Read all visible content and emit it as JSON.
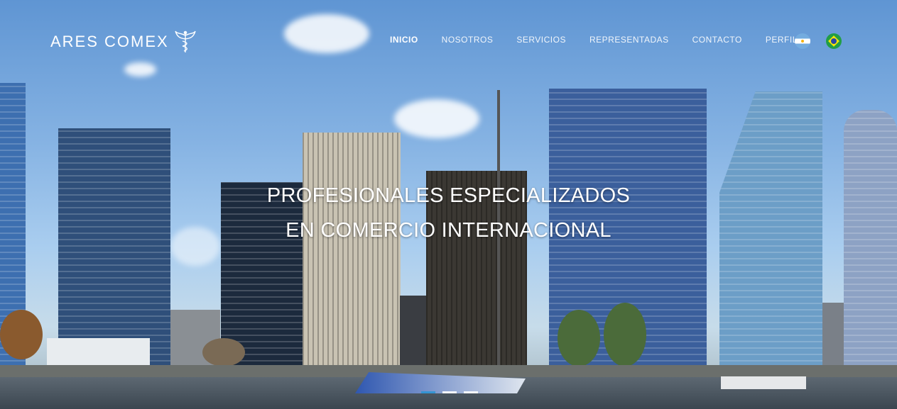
{
  "brand": {
    "name": "ARES COMEX",
    "logo_icon": "caduceus-wings-icon"
  },
  "nav": {
    "items": [
      {
        "label": "INICIO",
        "active": true
      },
      {
        "label": "NOSOTROS",
        "active": false
      },
      {
        "label": "SERVICIOS",
        "active": false
      },
      {
        "label": "REPRESENTADAS",
        "active": false
      },
      {
        "label": "CONTACTO",
        "active": false
      },
      {
        "label": "PERFIL",
        "active": false
      }
    ],
    "languages": [
      {
        "icon": "argentina-flag-icon"
      },
      {
        "icon": "brazil-flag-icon"
      }
    ]
  },
  "hero": {
    "headline_line1": "PROFESIONALES ESPECIALIZADOS",
    "headline_line2": "EN COMERCIO INTERNACIONAL",
    "slide_count": 3,
    "active_slide": 1
  },
  "colors": {
    "accent": "#2d95d4",
    "text": "#ffffff"
  }
}
